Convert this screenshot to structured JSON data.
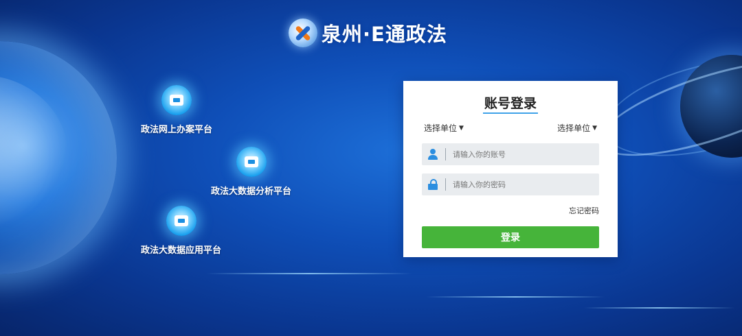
{
  "app": {
    "logo_text": "泉州·E通政法"
  },
  "platforms": [
    {
      "label": "政法网上办案平台",
      "icon": "computer-document-icon"
    },
    {
      "label": "政法大数据分析平台",
      "icon": "data-analysis-icon"
    },
    {
      "label": "政法大数据应用平台",
      "icon": "cloud-app-icon"
    }
  ],
  "login": {
    "title": "账号登录",
    "unit_select_left": "选择单位",
    "unit_select_right": "选择单位",
    "username_placeholder": "请输入你的账号",
    "password_placeholder": "请输入你的密码",
    "forgot_password": "忘记密码",
    "submit_label": "登录"
  },
  "colors": {
    "accent_blue": "#2b8ee0",
    "login_button": "#46b43a",
    "background": "#0f4fb8"
  }
}
